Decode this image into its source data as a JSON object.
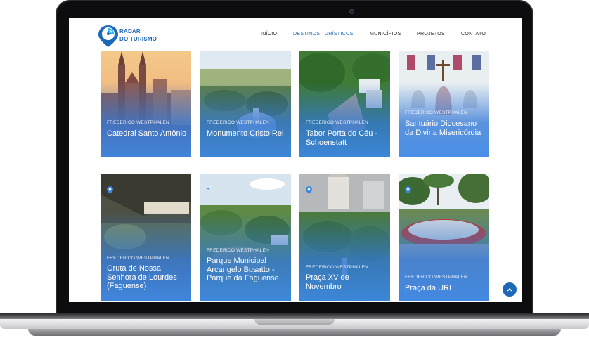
{
  "nav": {
    "brand_line1": "RADAR",
    "brand_line2": "DO TURISMO",
    "items": [
      {
        "label": "INÍCIO",
        "active": false
      },
      {
        "label": "DESTINOS TURÍSTICOS",
        "active": true
      },
      {
        "label": "MUNICÍPIOS",
        "active": false
      },
      {
        "label": "PROJETOS",
        "active": false
      },
      {
        "label": "CONTATO",
        "active": false
      }
    ]
  },
  "colors": {
    "brand": "#1f67b7",
    "card_overlay": "#3c87e6"
  },
  "cards": [
    {
      "city": "FREDERICO WESTPHALEN",
      "title": "Catedral Santo Antônio"
    },
    {
      "city": "FREDERICO WESTPHALEN",
      "title": "Monumento Cristo Rei"
    },
    {
      "city": "FREDERICO WESTPHALEN",
      "title": "Tabor Porta do Céu - Schoenstatt"
    },
    {
      "city": "FREDERICO WESTPHALEN",
      "title": "Santuário Diocesano da Divina Misericórdia"
    },
    {
      "city": "FREDERICO WESTPHALEN",
      "title": "Gruta de Nossa Senhora de Lourdes (Faguense)"
    },
    {
      "city": "FREDERICO WESTPHALEN",
      "title": "Parque Municipal Arcangelo Busatto - Parque da Faguense"
    },
    {
      "city": "FREDERICO WESTPHALEN",
      "title": "Praça XV de Novembro"
    },
    {
      "city": "FREDERICO WESTPHALEN",
      "title": "Praça da URI"
    }
  ],
  "scroll_top_icon": "chevron-up-icon"
}
